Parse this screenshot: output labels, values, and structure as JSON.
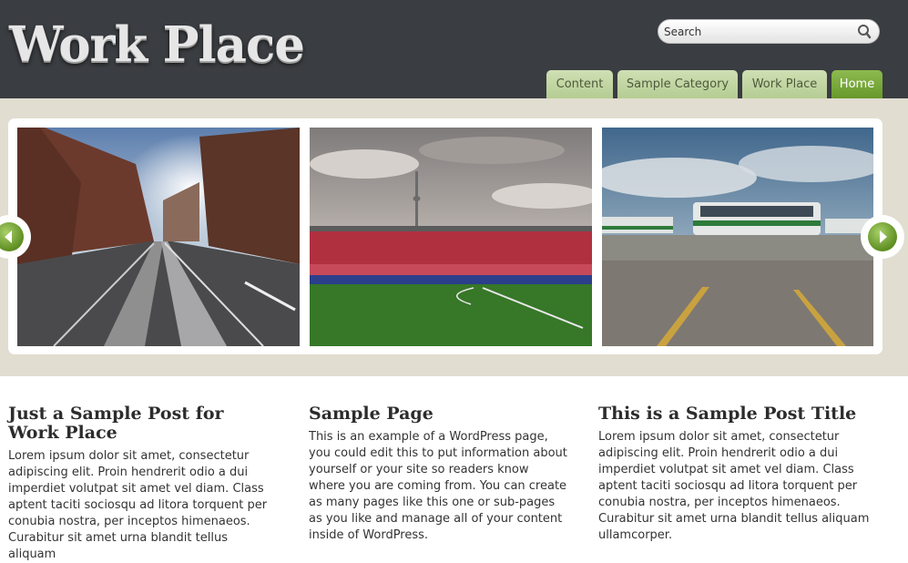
{
  "header": {
    "site_title": "Work Place",
    "search_placeholder": "Search"
  },
  "nav": {
    "items": [
      {
        "label": "Content",
        "active": false
      },
      {
        "label": "Sample Category",
        "active": false
      },
      {
        "label": "Work Place",
        "active": false
      },
      {
        "label": "Home",
        "active": true
      }
    ]
  },
  "slider": {
    "slides": [
      "street-photo",
      "stadium-photo",
      "parking-lot-bus-photo"
    ]
  },
  "posts": [
    {
      "title": "Just a Sample Post for Work Place",
      "excerpt": "Lorem ipsum dolor sit amet, consectetur adipiscing elit. Proin hendrerit odio a dui imperdiet volutpat sit amet vel diam. Class aptent taciti sociosqu ad litora torquent per conubia nostra, per inceptos himenaeos. Curabitur sit amet urna blandit tellus aliquam"
    },
    {
      "title": "Sample Page",
      "excerpt": "This is an example of a WordPress page, you could edit this to put information about yourself or your site so readers know where you are coming from. You can create as many pages like this one or sub-pages as you like and manage all of your content inside of WordPress."
    },
    {
      "title": "This is a Sample Post Title",
      "excerpt": "Lorem ipsum dolor sit amet, consectetur adipiscing elit. Proin hendrerit odio a dui imperdiet volutpat sit amet vel diam. Class aptent taciti sociosqu ad litora torquent per conubia nostra, per inceptos himenaeos. Curabitur sit amet urna blandit tellus aliquam ullamcorper."
    }
  ],
  "colors": {
    "header_bg": "#3a3d41",
    "nav_tab": "#c4d8a3",
    "nav_active": "#6fa032",
    "band_bg": "#e1ddd0"
  }
}
